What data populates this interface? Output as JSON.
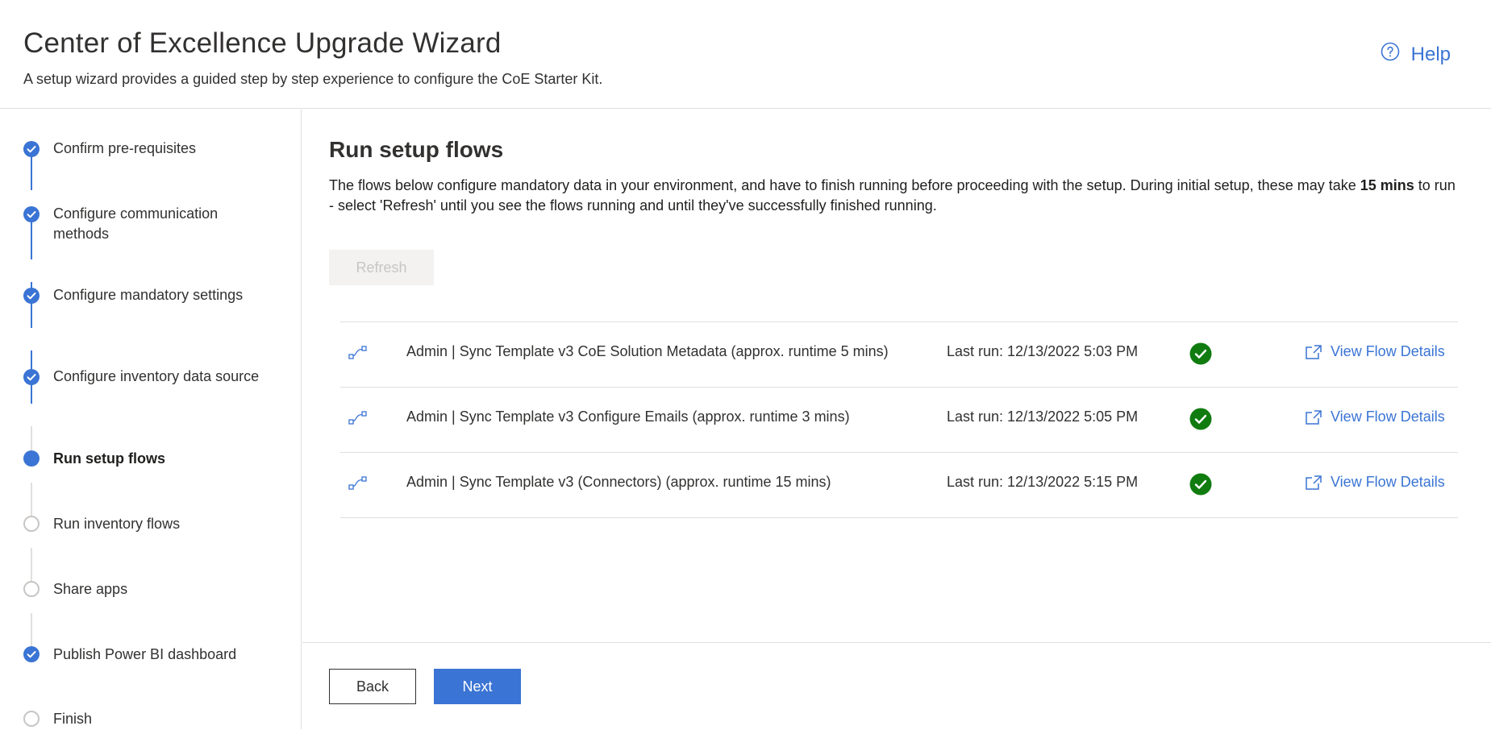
{
  "header": {
    "title": "Center of Excellence Upgrade Wizard",
    "subtitle": "A setup wizard provides a guided step by step experience to configure the CoE Starter Kit.",
    "help_label": "Help"
  },
  "steps": [
    {
      "label": "Confirm pre-requisites",
      "status": "complete"
    },
    {
      "label": "Configure communication methods",
      "status": "complete"
    },
    {
      "label": "Configure mandatory settings",
      "status": "complete"
    },
    {
      "label": "Configure inventory data source",
      "status": "complete"
    },
    {
      "label": "Run setup flows",
      "status": "current"
    },
    {
      "label": "Run inventory flows",
      "status": "incomplete"
    },
    {
      "label": "Share apps",
      "status": "incomplete"
    },
    {
      "label": "Publish Power BI dashboard",
      "status": "complete"
    },
    {
      "label": "Finish",
      "status": "incomplete"
    }
  ],
  "main": {
    "title": "Run setup flows",
    "desc_part1": "The flows below configure mandatory data in your environment, and have to finish running before proceeding with the setup. During initial setup, these may take ",
    "desc_bold": "15 mins",
    "desc_part2": " to run - select 'Refresh' until you see the flows running and until they've successfully finished running.",
    "refresh_label": "Refresh",
    "flows": [
      {
        "name": "Admin | Sync Template v3 CoE Solution Metadata (approx. runtime 5 mins)",
        "last_run": "Last run: 12/13/2022 5:03 PM",
        "link": "View Flow Details"
      },
      {
        "name": "Admin | Sync Template v3 Configure Emails (approx. runtime 3 mins)",
        "last_run": "Last run: 12/13/2022 5:05 PM",
        "link": "View Flow Details"
      },
      {
        "name": "Admin | Sync Template v3 (Connectors) (approx. runtime 15 mins)",
        "last_run": "Last run: 12/13/2022 5:15 PM",
        "link": "View Flow Details"
      }
    ]
  },
  "footer": {
    "back_label": "Back",
    "next_label": "Next"
  },
  "colors": {
    "accent": "#3a74d4",
    "success": "#107c10",
    "border": "#e1dfdd"
  },
  "icons": {
    "help": "help-circle-icon",
    "step_complete": "checkmark-circle-icon",
    "flow": "flow-icon",
    "status_ok": "success-check-icon",
    "external": "open-in-new-window-icon"
  }
}
